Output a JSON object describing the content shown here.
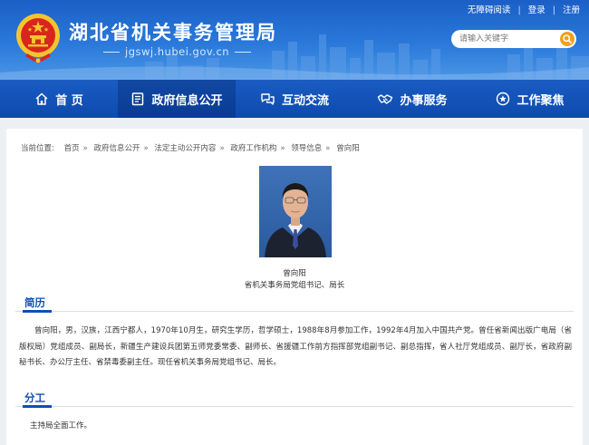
{
  "header": {
    "title": "湖北省机关事务管理局",
    "url": "jgswj.hubei.gov.cn",
    "top_links": [
      "无障碍阅读",
      "登录",
      "注册"
    ],
    "search": {
      "placeholder": "请输入关键字"
    }
  },
  "nav": {
    "items": [
      {
        "label": "首 页",
        "icon": "home-icon"
      },
      {
        "label": "政府信息公开",
        "icon": "document-icon"
      },
      {
        "label": "互动交流",
        "icon": "chat-icon"
      },
      {
        "label": "办事服务",
        "icon": "handshake-icon"
      },
      {
        "label": "工作聚焦",
        "icon": "star-icon"
      }
    ],
    "active_index": 1
  },
  "breadcrumb": {
    "label": "当前位置:",
    "items": [
      "首页",
      "政府信息公开",
      "法定主动公开内容",
      "政府工作机构",
      "领导信息",
      "曾向阳"
    ]
  },
  "leader": {
    "name": "曾向阳",
    "title": "省机关事务局党组书记、局长"
  },
  "sections": {
    "bio_heading": "简历",
    "bio_text": "曾向阳，男，汉族，江西宁都人，1970年10月生，研究生学历，哲学硕士，1988年8月参加工作，1992年4月加入中国共产党。曾任省新闻出版广电局（省版权局）党组成员、副局长，新疆生产建设兵团第五师党委常委、副师长、省援疆工作前方指挥部党组副书记、副总指挥，省人社厅党组成员、副厅长，省政府副秘书长、办公厅主任、省禁毒委副主任。现任省机关事务局党组书记、局长。",
    "duty_heading": "分工",
    "duty_text": "主持局全面工作。"
  },
  "colors": {
    "primary": "#0f4fb4",
    "search_button": "#f0a020",
    "emblem_red": "#d8261c",
    "emblem_gold": "#f4c430"
  }
}
